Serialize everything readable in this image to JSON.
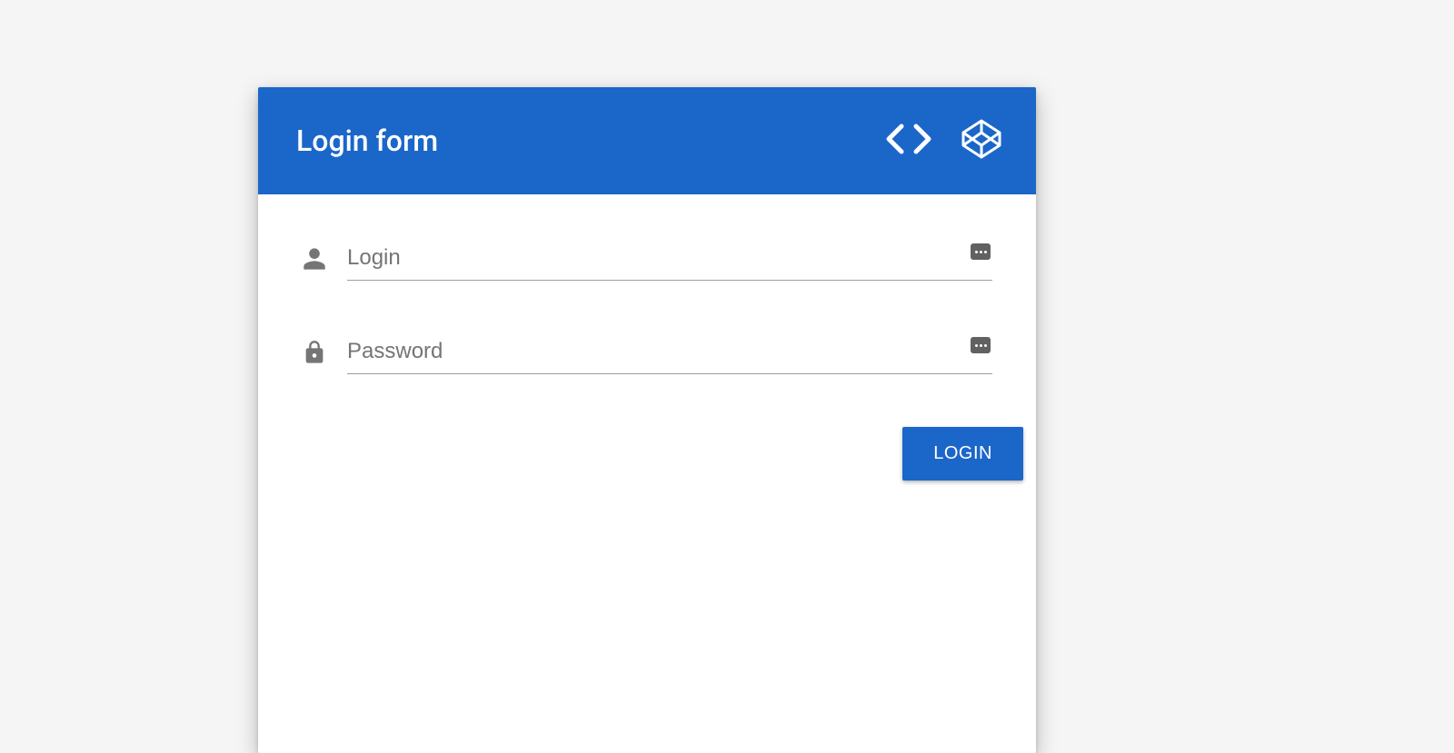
{
  "header": {
    "title": "Login form"
  },
  "fields": {
    "login": {
      "placeholder": "Login",
      "value": ""
    },
    "password": {
      "placeholder": "Password",
      "value": ""
    }
  },
  "actions": {
    "login_button": "LOGIN"
  },
  "colors": {
    "primary": "#1b66c9",
    "icon": "#757575"
  }
}
